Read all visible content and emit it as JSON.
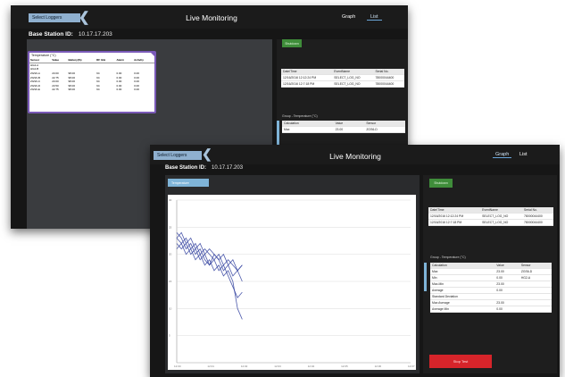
{
  "back_window": {
    "select_label": "Select Loggers",
    "title": "Live Monitoring",
    "tabs": [
      "Graph",
      "List"
    ],
    "active_tab": "List",
    "base_label": "Base Station ID:",
    "base_value": "10.17.17.203",
    "green_button": "Shutdown",
    "popup": {
      "title": "Temperature (°C)",
      "columns": [
        "Sensor",
        "Value",
        "Battery(%)",
        "RF link",
        "Alarm",
        "Activity"
      ],
      "rows": [
        [
          "HG2-A",
          "",
          "",
          "",
          "",
          ""
        ],
        [
          "HG2-B",
          "",
          "",
          "",
          "",
          ""
        ],
        [
          "ZGS6-A",
          "23.00",
          "98.00",
          "94",
          "0.00",
          "0.00"
        ],
        [
          "ZGS6-B",
          "22.75",
          "98.00",
          "94",
          "0.00",
          "0.00"
        ],
        [
          "ZGS6-C",
          "23.00",
          "98.00",
          "94",
          "0.00",
          "0.00"
        ],
        [
          "ZGS6-D",
          "23.50",
          "98.00",
          "94",
          "0.00",
          "0.00"
        ],
        [
          "ZGS6-E",
          "22.75",
          "98.00",
          "94",
          "0.00",
          "0.00"
        ]
      ]
    },
    "events": {
      "columns": [
        "Date/Time",
        "EventName",
        "Serial No."
      ],
      "rows": [
        [
          "12/16/2016 12:12:24 PM",
          "SELECT_LOG_NO",
          "78000044400"
        ],
        [
          "12/16/2016 12:7:18 PM",
          "SELECT_LOG_NO",
          "78000044400"
        ]
      ]
    },
    "group_label": "Group - Temperature (°C)",
    "group": {
      "columns": [
        "Calculation",
        "Value",
        "Sensor"
      ],
      "rows": [
        [
          "Max",
          "23.00",
          "ZGS6-D"
        ]
      ]
    }
  },
  "front_window": {
    "select_label": "Select Loggers",
    "title": "Live Monitoring",
    "tabs": [
      "Graph",
      "List"
    ],
    "active_tab": "Graph",
    "base_label": "Base Station ID:",
    "base_value": "10.17.17.203",
    "chart_button": "Temperature",
    "green_button": "Shutdown",
    "events": {
      "columns": [
        "Date/Time",
        "EventName",
        "Serial No."
      ],
      "rows": [
        [
          "12/16/2016 12:12:24 PM",
          "SELECT_LOG_NO",
          "78000044400"
        ],
        [
          "12/16/2016 12:7:18 PM",
          "SELECT_LOG_NO",
          "78000044400"
        ]
      ]
    },
    "group_label": "Group - Temperature (°C)",
    "group": {
      "columns": [
        "Calculation",
        "Value",
        "Sensor"
      ],
      "rows": [
        [
          "Max",
          "23.00",
          "ZGS6-D"
        ],
        [
          "Min",
          "0.00",
          "HG2-A"
        ],
        [
          "Max-Min",
          "23.00",
          ""
        ],
        [
          "Average",
          "0.00",
          ""
        ],
        [
          "Standard Deviation",
          "",
          ""
        ],
        [
          "Max Average",
          "23.00",
          ""
        ],
        [
          "Average Min",
          "0.00",
          ""
        ]
      ]
    },
    "red_button": "Stop Test"
  },
  "chart_data": {
    "type": "line",
    "title": "",
    "xlabel": "",
    "ylabel": "",
    "ylim": [
      0,
      30
    ],
    "y_ticks": [
      "30",
      "25",
      "20",
      "15",
      "10",
      "5"
    ],
    "x_ticks": [
      "12:00",
      "12:01",
      "12:02",
      "12:03",
      "12:04",
      "12:05",
      "12:06",
      "12:07"
    ],
    "x": [
      0,
      0.02,
      0.04,
      0.06,
      0.08,
      0.1,
      0.12,
      0.14,
      0.16,
      0.18,
      0.2,
      0.22,
      0.24,
      0.26,
      0.28
    ],
    "series": [
      {
        "values": [
          24,
          23,
          21,
          22,
          20,
          21,
          19,
          18,
          20,
          19,
          17,
          18,
          16,
          17,
          15
        ]
      },
      {
        "values": [
          23,
          22,
          23,
          21,
          22,
          20,
          21,
          20,
          19,
          20,
          18,
          19,
          18,
          17,
          18
        ]
      },
      {
        "values": [
          22,
          21,
          22,
          20,
          21,
          19,
          20,
          18,
          19,
          17,
          18,
          16,
          14,
          12,
          13
        ]
      },
      {
        "values": [
          21,
          22,
          20,
          21,
          19,
          20,
          18,
          19,
          17,
          18,
          16,
          17,
          15,
          10,
          8
        ]
      },
      {
        "values": [
          23,
          24,
          22,
          23,
          21,
          22,
          20,
          21,
          20,
          19,
          20,
          18,
          19,
          17,
          18
        ]
      }
    ],
    "line_color": "#2f3e9e",
    "grid": true
  }
}
